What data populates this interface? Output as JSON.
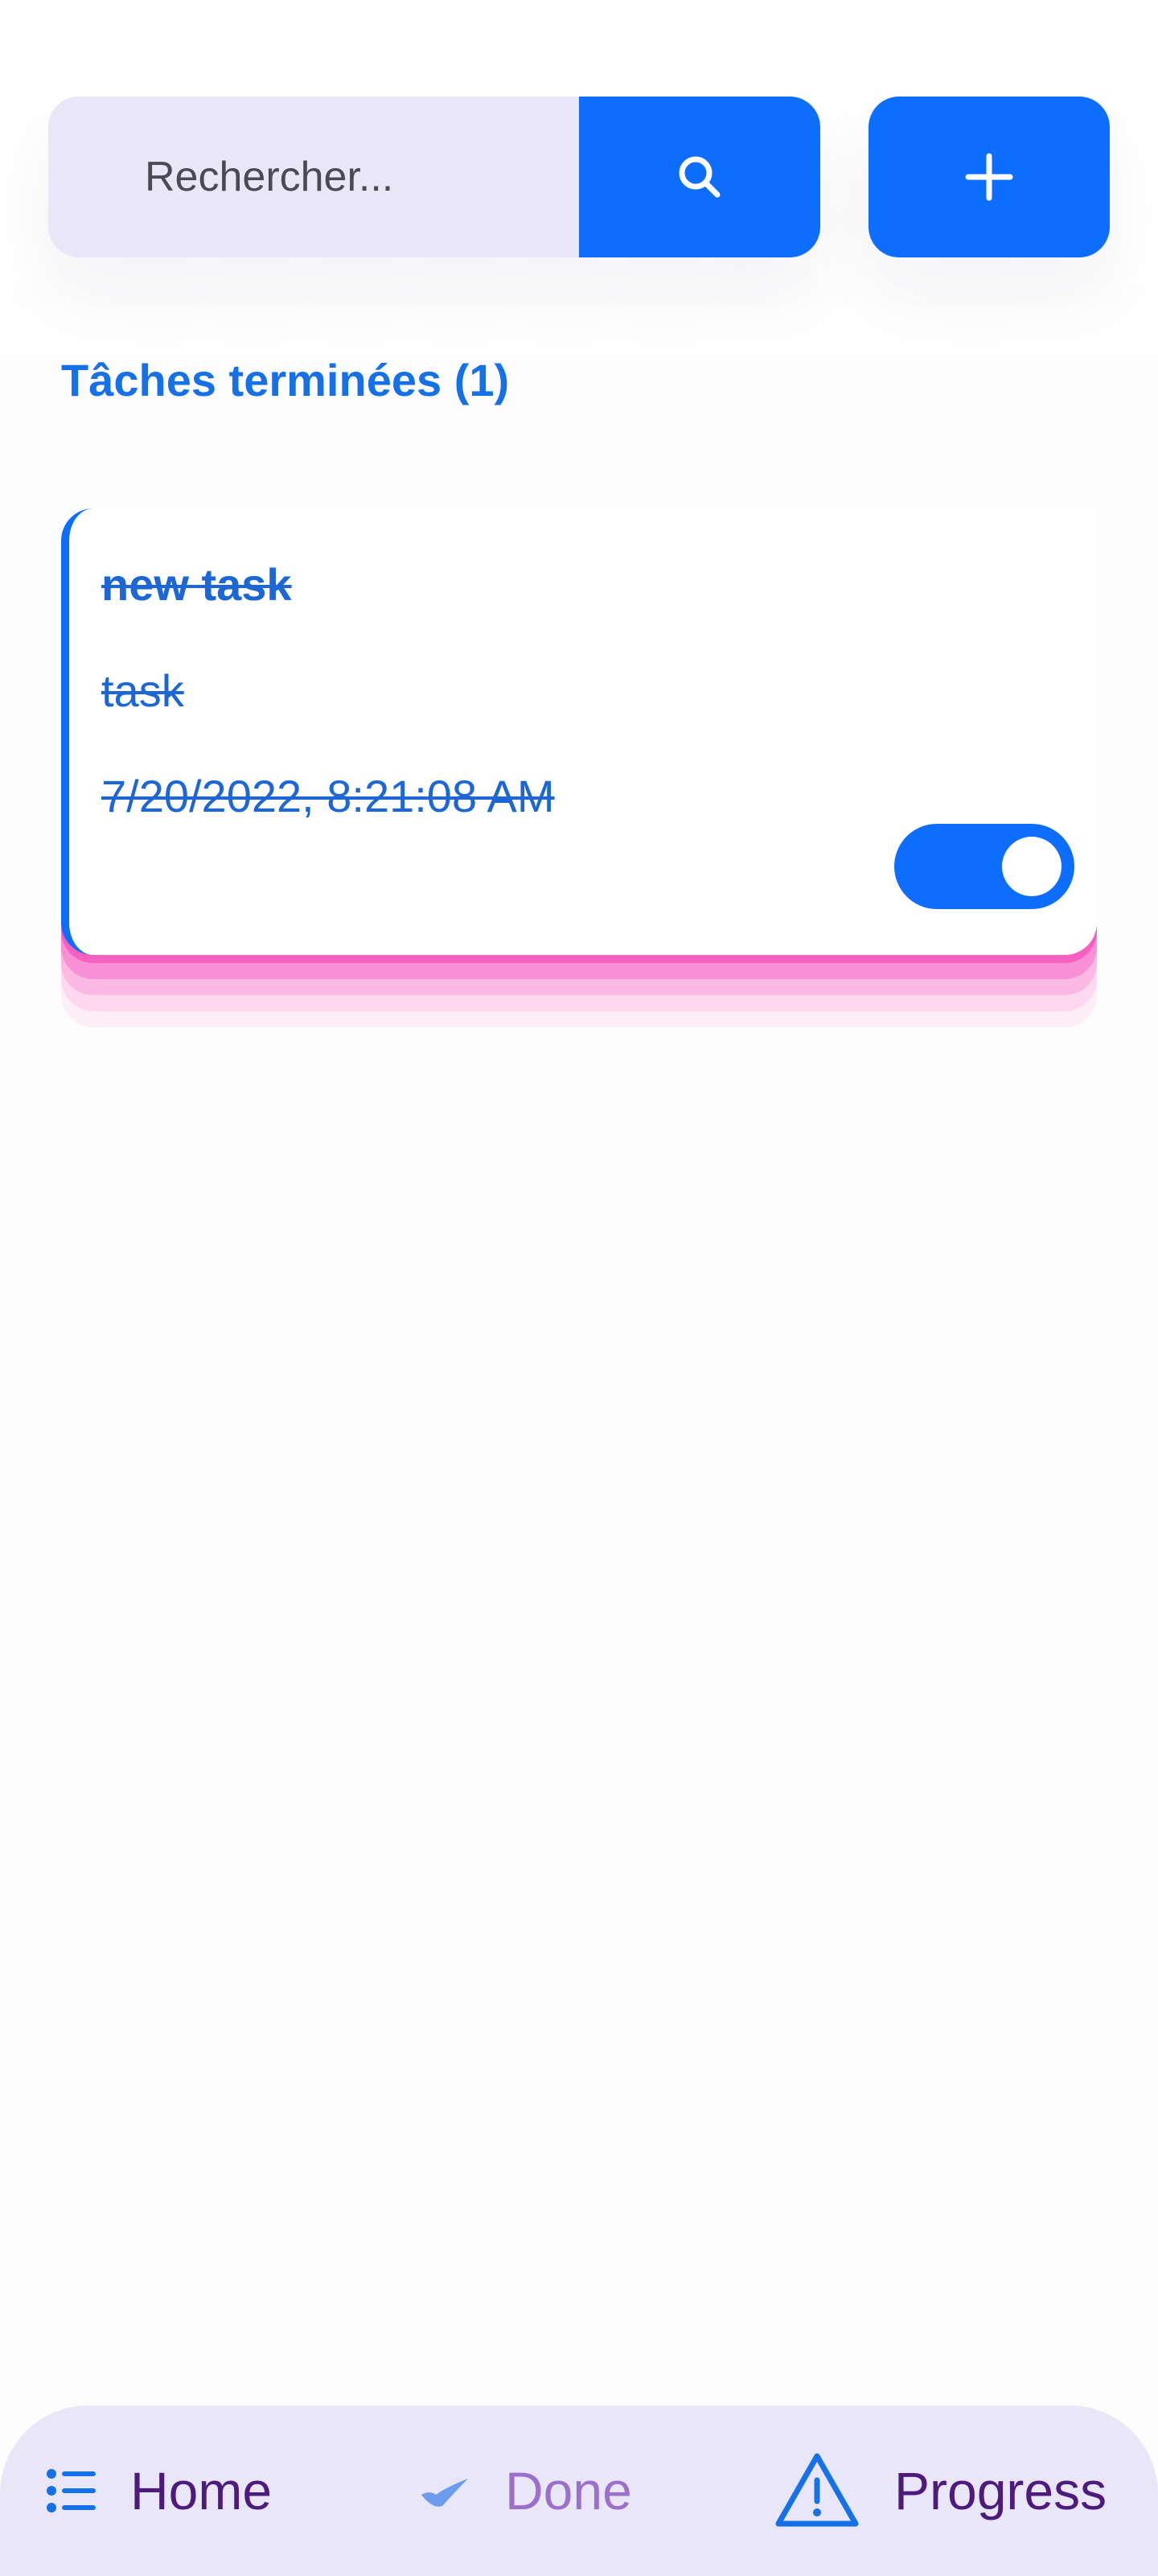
{
  "search": {
    "placeholder": "Rechercher...",
    "search_icon": "search-icon",
    "add_icon": "plus-icon"
  },
  "section": {
    "title": "Tâches terminées (1)"
  },
  "tasks": [
    {
      "title": "new task",
      "description": "task",
      "date": "7/20/2022, 8:21:08 AM",
      "done": true
    }
  ],
  "nav": {
    "items": [
      {
        "label": "Home",
        "icon": "list-icon"
      },
      {
        "label": "Done",
        "icon": "check-icon"
      },
      {
        "label": "Progress",
        "icon": "warning-icon"
      }
    ]
  },
  "colors": {
    "accent": "#0d6efd",
    "title_text": "#1670e8",
    "nav_background": "#e9e6f8",
    "nav_text": "#4d1a7e",
    "nav_text_muted": "#9b6fcb",
    "card_stack": "#f75fc0"
  }
}
